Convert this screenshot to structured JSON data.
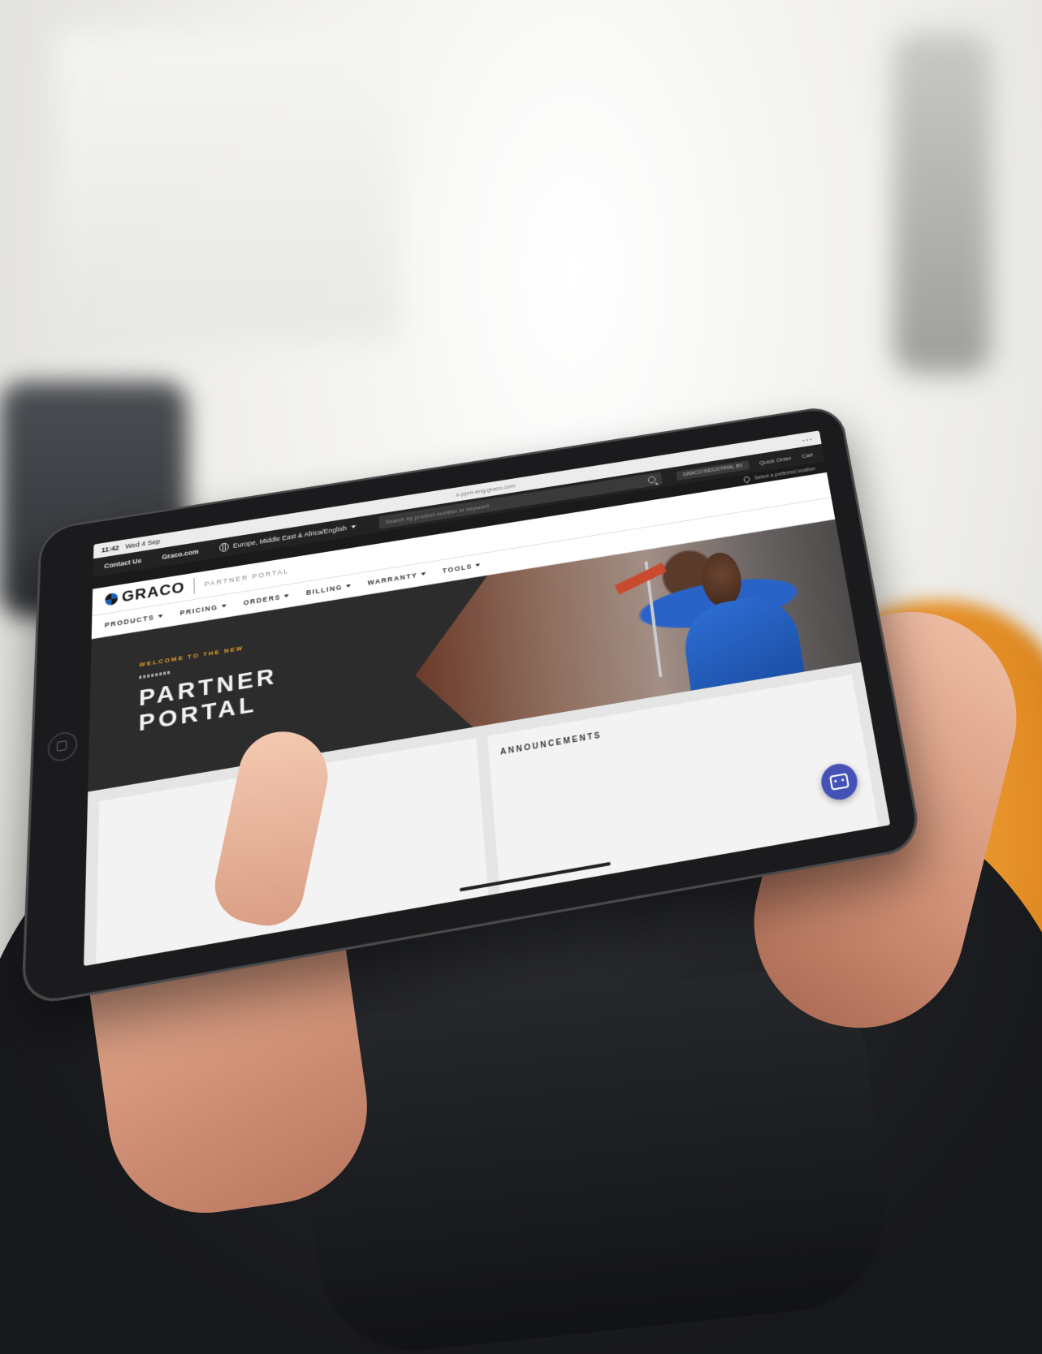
{
  "status_bar": {
    "time": "11:42",
    "date": "Wed 4 Sep",
    "url": "e.ppm-eng.graco.com",
    "dots": "•••"
  },
  "utility_bar": {
    "contact_label": "Contact Us",
    "graco_link_label": "Graco.com",
    "region_label": "Europe, Middle East & Africa/English",
    "search_placeholder": "Search by product number or keyword",
    "account_label": "GRACO INDUSTRIAL BV",
    "quick_order_label": "Quick Order",
    "cart_label": "Cart"
  },
  "location_bar": {
    "label": "Select a preferred location"
  },
  "header": {
    "logo_text": "GRACO",
    "portal_label": "PARTNER PORTAL"
  },
  "nav": {
    "items": [
      {
        "label": "PRODUCTS"
      },
      {
        "label": "PRICING"
      },
      {
        "label": "ORDERS"
      },
      {
        "label": "BILLING"
      },
      {
        "label": "WARRANTY"
      },
      {
        "label": "TOOLS"
      }
    ]
  },
  "hero": {
    "kicker": "WELCOME TO THE NEW",
    "title_line1": "PARTNER",
    "title_line2": "PORTAL"
  },
  "announcements": {
    "title": "ANNOUNCEMENTS"
  },
  "colors": {
    "accent": "#e3a12b",
    "brand_blue": "#1b5fb5",
    "chat_button": "#4452b8",
    "hero_bg": "#2c2c2c"
  },
  "icons": {
    "globe": "globe-icon",
    "search": "search-icon",
    "chevron": "chevron-down-icon",
    "chat": "chat-icon",
    "pin": "pin-icon"
  }
}
